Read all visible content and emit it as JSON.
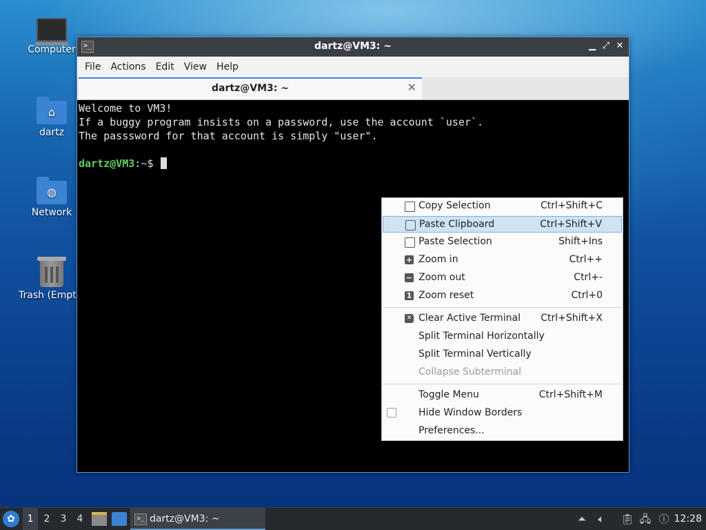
{
  "desktop": {
    "icons": [
      {
        "label": "Computer"
      },
      {
        "label": "dartz"
      },
      {
        "label": "Network"
      },
      {
        "label": "Trash (Empty)"
      }
    ]
  },
  "window": {
    "title": "dartz@VM3: ~",
    "buttons": {
      "minimize": "▁",
      "maximize": "⤢",
      "close": "✕"
    },
    "menu": [
      "File",
      "Actions",
      "Edit",
      "View",
      "Help"
    ],
    "tab": {
      "label": "dartz@VM3: ~",
      "close": "✕"
    },
    "terminal": {
      "lines": [
        "Welcome to VM3!",
        "If a buggy program insists on a password, use the account `user`.",
        "The passsword for that account is simply \"user\"."
      ],
      "prompt_user": "dartz@VM3",
      "prompt_sep": ":",
      "prompt_path": "~",
      "prompt_symbol": "$"
    }
  },
  "context_menu": {
    "items": [
      {
        "label": "Copy Selection",
        "shortcut": "Ctrl+Shift+C",
        "icon": "copy-icon"
      },
      {
        "label": "Paste Clipboard",
        "shortcut": "Ctrl+Shift+V",
        "icon": "paste-icon",
        "highlighted": true
      },
      {
        "label": "Paste Selection",
        "shortcut": "Shift+Ins",
        "icon": "paste-icon"
      },
      {
        "label": "Zoom in",
        "shortcut": "Ctrl++",
        "icon": "zoom-in-icon"
      },
      {
        "label": "Zoom out",
        "shortcut": "Ctrl+-",
        "icon": "zoom-out-icon"
      },
      {
        "label": "Zoom reset",
        "shortcut": "Ctrl+0",
        "icon": "zoom-reset-icon"
      },
      {
        "label": "Clear Active Terminal",
        "shortcut": "Ctrl+Shift+X",
        "icon": "clear-icon"
      },
      {
        "label": "Split Terminal Horizontally",
        "shortcut": ""
      },
      {
        "label": "Split Terminal Vertically",
        "shortcut": ""
      },
      {
        "label": "Collapse Subterminal",
        "shortcut": "",
        "disabled": true
      },
      {
        "label": "Toggle Menu",
        "shortcut": "Ctrl+Shift+M"
      },
      {
        "label": "Hide Window Borders",
        "shortcut": "",
        "checkbox": false
      },
      {
        "label": "Preferences...",
        "shortcut": ""
      }
    ]
  },
  "taskbar": {
    "workspaces": [
      "1",
      "2",
      "3",
      "4"
    ],
    "active_workspace": "1",
    "task_label": "dartz@VM3: ~",
    "clock": "12:28"
  },
  "colors": {
    "accent": "#3d8ad8",
    "menu_highlight": "#cfe3f5",
    "prompt_user": "#5ed05e",
    "prompt_path": "#6aa6f0"
  }
}
